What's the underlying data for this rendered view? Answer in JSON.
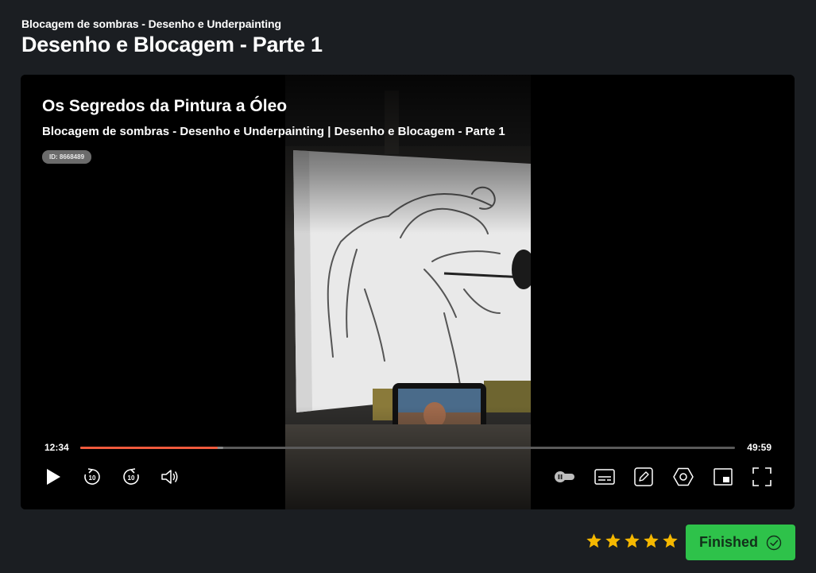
{
  "header": {
    "breadcrumb": "Blocagem de sombras - Desenho e Underpainting",
    "title": "Desenho e Blocagem - Parte 1"
  },
  "player": {
    "course_title": "Os Segredos da Pintura a Óleo",
    "lesson_subtitle": "Blocagem de sombras - Desenho e Underpainting | Desenho e Blocagem - Parte 1",
    "id_badge": "ID: 8668489",
    "current_time": "12:34",
    "total_time": "49:59",
    "progress_fraction": 0.2095,
    "buffer_fraction": 0.218,
    "progress_color": "#f05a3c",
    "controls": {
      "play": "play-icon",
      "rewind": "rewind-10-icon",
      "rewind_label": "10",
      "forward": "forward-10-icon",
      "forward_label": "10",
      "volume": "volume-icon",
      "autoplay": "autoplay-toggle-icon",
      "subtitles": "subtitles-icon",
      "notes": "pencil-icon",
      "settings": "settings-icon",
      "pip": "picture-in-picture-icon",
      "fullscreen": "fullscreen-icon"
    }
  },
  "rating": {
    "stars": 5,
    "max": 5,
    "color": "#f5b800"
  },
  "finished_button": {
    "label": "Finished",
    "color": "#2ec24a"
  }
}
